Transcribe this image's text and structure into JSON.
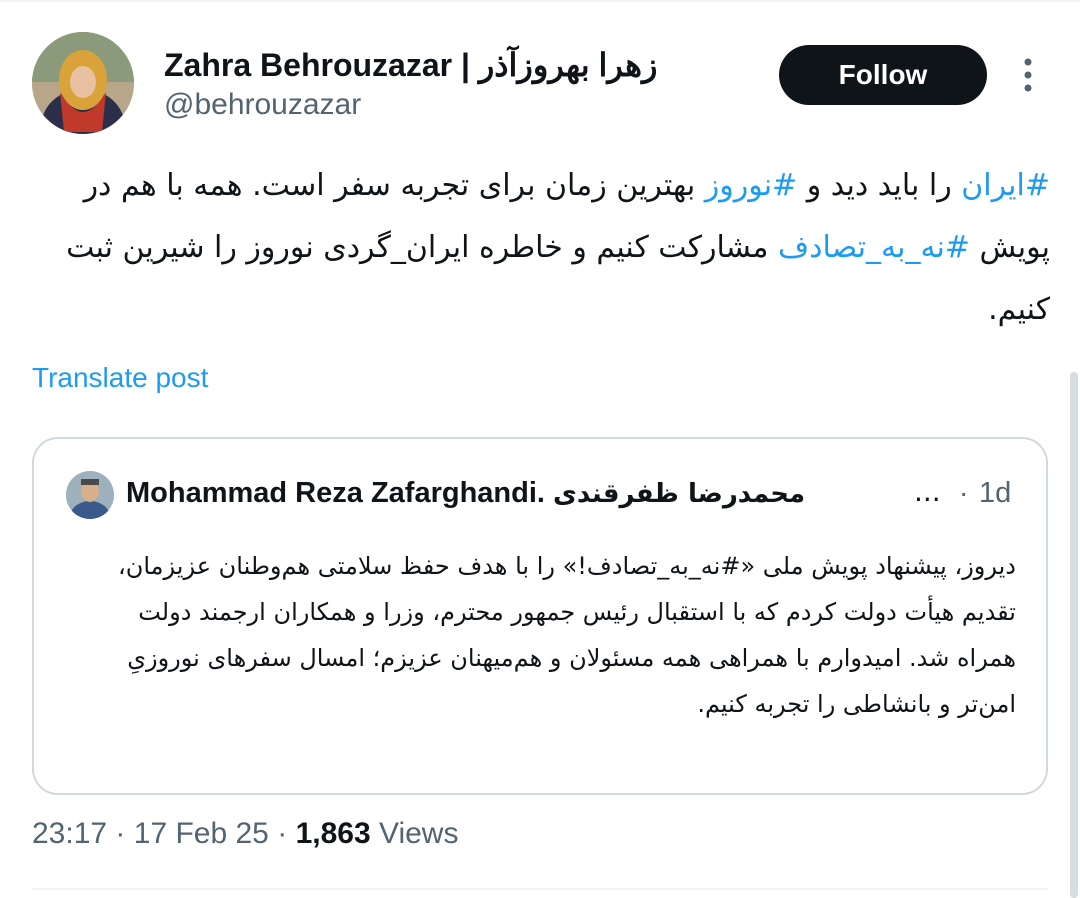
{
  "author": {
    "display_name": "Zahra Behrouzazar | زهرا بهروزآذر",
    "handle": "@behrouzazar",
    "follow_label": "Follow"
  },
  "post": {
    "segments": [
      {
        "text": "#ایران",
        "type": "hashtag"
      },
      {
        "text": " را باید دید و ",
        "type": "text"
      },
      {
        "text": "#نوروز",
        "type": "hashtag"
      },
      {
        "text": " بهترین زمان برای تجربه سفر است. همه با هم در پویش ",
        "type": "text"
      },
      {
        "text": "#نه_به_تصادف",
        "type": "hashtag"
      },
      {
        "text": " مشارکت کنیم و خاطره ایران_گردی نوروز را شیرین ثبت کنیم.",
        "type": "text"
      }
    ],
    "translate_label": "Translate post"
  },
  "quoted": {
    "name_en": "Mohammad Reza Zafarghandi.",
    "name_fa": "محمدرضا ظفرقندی",
    "ellipsis": "...",
    "separator": "·",
    "time": "1d",
    "text": "دیروز، پیشنهاد پویش ملی «#نه_به_تصادف!» را با هدف حفظ سلامتی هم‌وطنان عزیزمان، تقدیم هیأت دولت کردم که با استقبال رئیس جمهور محترم، وزرا و همکاران ارجمند دولت همراه شد. امیدوارم با همراهی همه مسئولان و هم‌میهنان عزیزم؛ امسال سفرهای نوروزیِ امن‌تر و بانشاطی را تجربه کنیم."
  },
  "meta": {
    "time": "23:17",
    "sep1": "·",
    "date": "17 Feb 25",
    "sep2": "·",
    "views_count": "1,863",
    "views_label": "Views"
  },
  "colors": {
    "link": "#1d9bf0",
    "text": "#0f1419",
    "secondary": "#536471",
    "border": "#cfd9de"
  },
  "icons": [
    "more-options-icon"
  ]
}
